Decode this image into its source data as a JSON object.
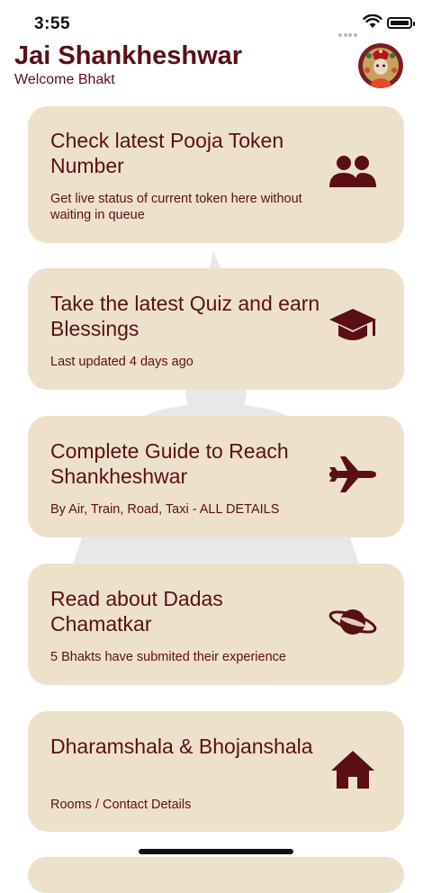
{
  "status_bar": {
    "time": "3:55"
  },
  "header": {
    "title": "Jai Shankheshwar",
    "subtitle": "Welcome Bhakt"
  },
  "cards": [
    {
      "title": "Check latest Pooja Token Number",
      "subtitle": "Get live status of current token here without waiting in queue",
      "icon": "people-icon"
    },
    {
      "title": "Take the latest Quiz and earn Blessings",
      "subtitle": "Last updated 4 days ago",
      "icon": "graduation-cap-icon"
    },
    {
      "title": "Complete Guide to Reach Shankheshwar",
      "subtitle": "By Air, Train, Road, Taxi - ALL DETAILS",
      "icon": "airplane-icon"
    },
    {
      "title": "Read about Dadas Chamatkar",
      "subtitle": "5 Bhakts have submited their experience",
      "icon": "planet-icon"
    },
    {
      "title": "Dharamshala & Bhojanshala",
      "subtitle": "Rooms / Contact Details",
      "icon": "home-icon"
    }
  ],
  "colors": {
    "card_bg": "#eee1cb",
    "text": "#5a0f16",
    "background": "#ffffff"
  }
}
